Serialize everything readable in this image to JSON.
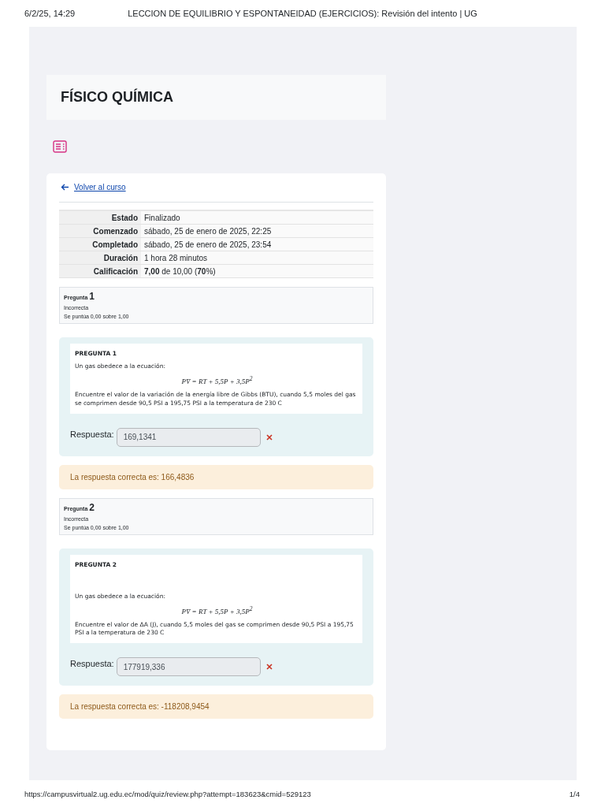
{
  "print_header": {
    "date": "6/2/25, 14:29",
    "title": "LECCION DE EQUILIBRIO Y ESPONTANEIDAD (EJERCICIOS): Revisión del intento | UG"
  },
  "course_title": "FÍSICO QUÍMICA",
  "back_link": "Volver al curso",
  "summary": [
    {
      "label": "Estado",
      "value": "Finalizado"
    },
    {
      "label": "Comenzado",
      "value": "sábado, 25 de enero de 2025, 22:25"
    },
    {
      "label": "Completado",
      "value": "sábado, 25 de enero de 2025, 23:54"
    },
    {
      "label": "Duración",
      "value": "1 hora 28 minutos"
    },
    {
      "label": "Calificación",
      "value": "**7,00** de 10,00 (**70**%)"
    }
  ],
  "questions": [
    {
      "label": "Pregunta",
      "number": "1",
      "state": "Incorrecta",
      "grade": "Se puntúa 0,00 sobre 1,00",
      "heading": "PREGUNTA 1",
      "paragraphs": [
        "Un gas obedece a la ecuación:"
      ],
      "equation": "PV̄ = RT + 5,5P + 3,5P$^{2}$",
      "prompt": "Encuentre el valor de la variación de la energía libre de Gibbs (BTU), cuando 5,5 moles del gas se comprimen desde 90,5 PSI a 195,75 PSI a la temperatura de 230 C",
      "answer_label": "Respuesta:",
      "answer": "169,1341",
      "correct": false,
      "feedback": "La respuesta correcta es: 166,4836"
    },
    {
      "label": "Pregunta",
      "number": "2",
      "state": "Incorrecta",
      "grade": "Se puntúa 0,00 sobre 1,00",
      "heading": "PREGUNTA 2",
      "paragraphs": [
        "Un gas obedece a la ecuación:"
      ],
      "equation": "PV̄ = RT + 5,5P + 3,5P$^{2}$",
      "prompt": "Encuentre el valor de ΔA (J), cuando 5,5 moles del gas se comprimen desde 90,5 PSI a 195,75 PSI a la temperatura de 230 C",
      "answer_label": "Respuesta:",
      "answer": "177919,336",
      "correct": false,
      "feedback": "La respuesta correcta es: -118208,9454"
    }
  ],
  "print_footer": {
    "url": "https://campusvirtual2.ug.edu.ec/mod/quiz/review.php?attempt=183623&cmid=529123",
    "page": "1/4"
  }
}
